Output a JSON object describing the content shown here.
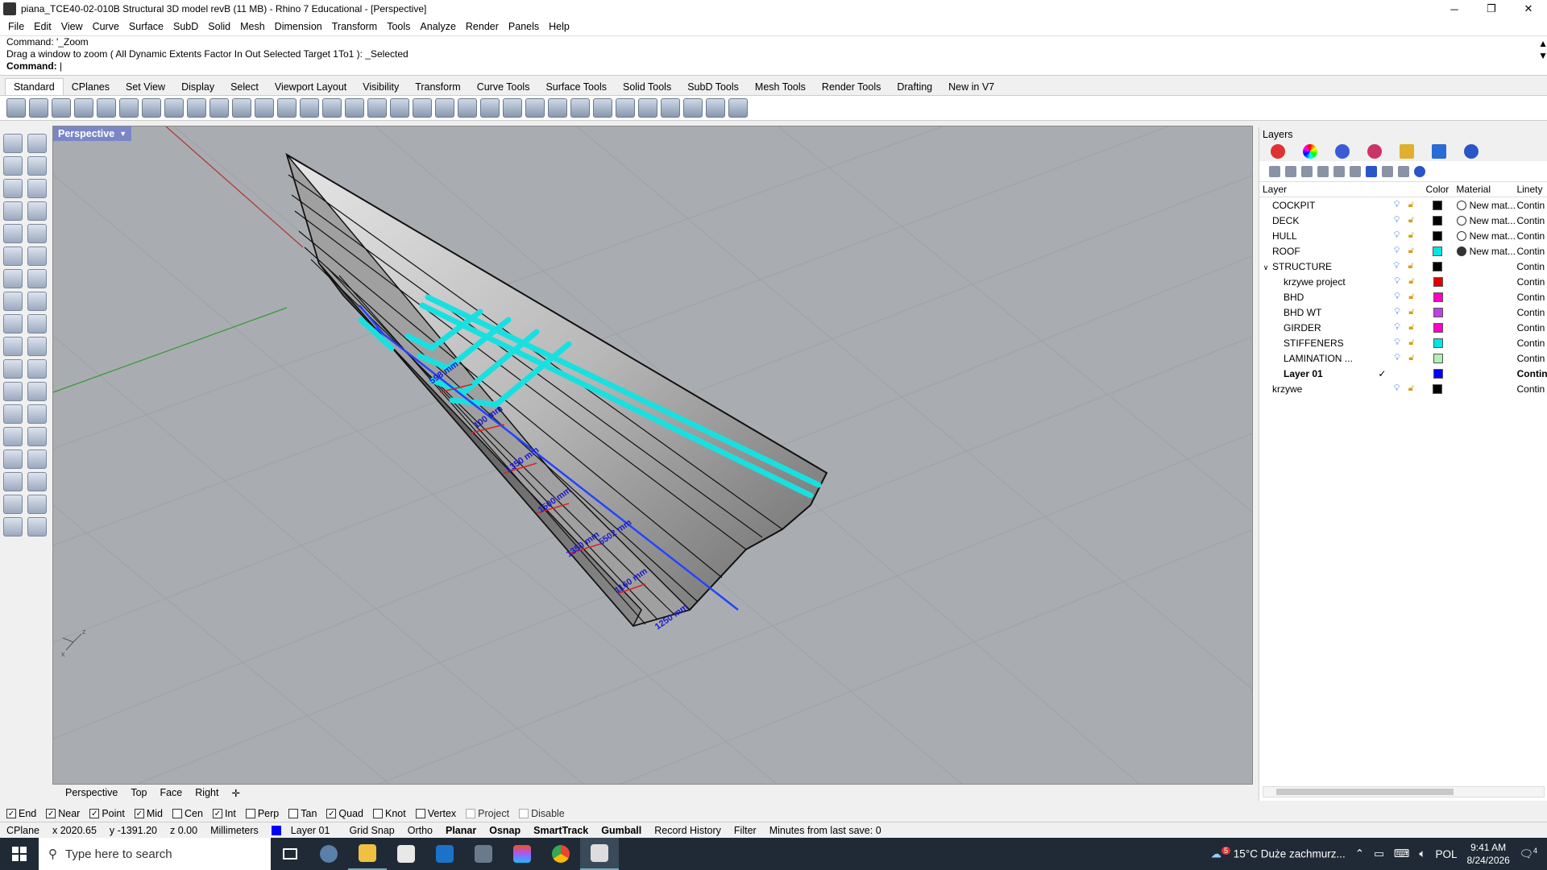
{
  "window": {
    "title": "piana_TCE40-02-010B Structural 3D model revB (11 MB) - Rhino 7 Educational - [Perspective]",
    "controls": {
      "minimize": "─",
      "maximize": "❐",
      "close": "✕"
    }
  },
  "menu": [
    "File",
    "Edit",
    "View",
    "Curve",
    "Surface",
    "SubD",
    "Solid",
    "Mesh",
    "Dimension",
    "Transform",
    "Tools",
    "Analyze",
    "Render",
    "Panels",
    "Help"
  ],
  "command": {
    "line1": "Command: '_Zoom",
    "line2": "Drag a window to zoom ( All  Dynamic  Extents  Factor  In  Out  Selected  Target  1To1 ): _Selected",
    "prompt": "Command:"
  },
  "toolbar_tabs": [
    "Standard",
    "CPlanes",
    "Set View",
    "Display",
    "Select",
    "Viewport Layout",
    "Visibility",
    "Transform",
    "Curve Tools",
    "Surface Tools",
    "Solid Tools",
    "SubD Tools",
    "Mesh Tools",
    "Render Tools",
    "Drafting",
    "New in V7"
  ],
  "viewport": {
    "name": "Perspective",
    "dimensions": [
      "5502 mm",
      "598 mm",
      "100 mm",
      "1350 mm",
      "1500 mm",
      "1350 mm",
      "1160 mm",
      "1250 mm"
    ],
    "axis_labels": {
      "z": "z",
      "x": "x"
    }
  },
  "viewport_tabs": [
    "Perspective",
    "Top",
    "Face",
    "Right",
    "✛"
  ],
  "osnaps": [
    {
      "label": "End",
      "checked": true
    },
    {
      "label": "Near",
      "checked": true
    },
    {
      "label": "Point",
      "checked": true
    },
    {
      "label": "Mid",
      "checked": true
    },
    {
      "label": "Cen",
      "checked": false
    },
    {
      "label": "Int",
      "checked": true
    },
    {
      "label": "Perp",
      "checked": false
    },
    {
      "label": "Tan",
      "checked": false
    },
    {
      "label": "Quad",
      "checked": true
    },
    {
      "label": "Knot",
      "checked": false
    },
    {
      "label": "Vertex",
      "checked": false
    },
    {
      "label": "Project",
      "checked": false
    },
    {
      "label": "Disable",
      "checked": false
    }
  ],
  "status": {
    "cplane": "CPlane",
    "x": "x 2020.65",
    "y": "y -1391.20",
    "z": "z 0.00",
    "units": "Millimeters",
    "layer": "Layer 01",
    "grid_snap": "Grid Snap",
    "ortho": "Ortho",
    "planar": "Planar",
    "osnap": "Osnap",
    "smarttrack": "SmartTrack",
    "gumball": "Gumball",
    "record_history": "Record History",
    "filter": "Filter",
    "save_info": "Minutes from last save: 0"
  },
  "layers": {
    "title": "Layers",
    "headers": {
      "layer": "Layer",
      "color": "Color",
      "material": "Material",
      "linetype": "Linety"
    },
    "rows": [
      {
        "name": "COCKPIT",
        "indent": 0,
        "color": "#000000",
        "material": "New mat...",
        "mat_dark": false,
        "linetype": "Contin",
        "current": false
      },
      {
        "name": "DECK",
        "indent": 0,
        "color": "#000000",
        "material": "New mat...",
        "mat_dark": false,
        "linetype": "Contin",
        "current": false
      },
      {
        "name": "HULL",
        "indent": 0,
        "color": "#000000",
        "material": "New mat...",
        "mat_dark": false,
        "linetype": "Contin",
        "current": false
      },
      {
        "name": "ROOF",
        "indent": 0,
        "color": "#00e5e5",
        "material": "New mat...",
        "mat_dark": true,
        "linetype": "Contin",
        "current": false
      },
      {
        "name": "STRUCTURE",
        "indent": 0,
        "color": "#000000",
        "material": "",
        "mat_dark": false,
        "linetype": "Contin",
        "current": false,
        "expanded": true
      },
      {
        "name": "krzywe project",
        "indent": 1,
        "color": "#e00000",
        "material": "",
        "mat_dark": false,
        "linetype": "Contin",
        "current": false
      },
      {
        "name": "BHD",
        "indent": 1,
        "color": "#ff00c8",
        "material": "",
        "mat_dark": false,
        "linetype": "Contin",
        "current": false
      },
      {
        "name": "BHD WT",
        "indent": 1,
        "color": "#c040e0",
        "material": "",
        "mat_dark": false,
        "linetype": "Contin",
        "current": false
      },
      {
        "name": "GIRDER",
        "indent": 1,
        "color": "#ff00c8",
        "material": "",
        "mat_dark": false,
        "linetype": "Contin",
        "current": false
      },
      {
        "name": "STIFFENERS",
        "indent": 1,
        "color": "#00e5e5",
        "material": "",
        "mat_dark": false,
        "linetype": "Contin",
        "current": false
      },
      {
        "name": "LAMINATION ...",
        "indent": 1,
        "color": "#b0f0b0",
        "material": "",
        "mat_dark": false,
        "linetype": "Contin",
        "current": false
      },
      {
        "name": "Layer 01",
        "indent": 1,
        "color": "#0000ff",
        "material": "",
        "mat_dark": false,
        "linetype": "Contin",
        "current": true
      },
      {
        "name": "krzywe",
        "indent": 0,
        "color": "#000000",
        "material": "",
        "mat_dark": false,
        "linetype": "Contin",
        "current": false
      }
    ]
  },
  "taskbar": {
    "search_placeholder": "Type here to search",
    "weather": "15°C  Duże zachmurz...",
    "weather_badge": "5",
    "language": "POL",
    "time": "9:41 AM",
    "date": "8/24/2026",
    "notifications": "4"
  }
}
